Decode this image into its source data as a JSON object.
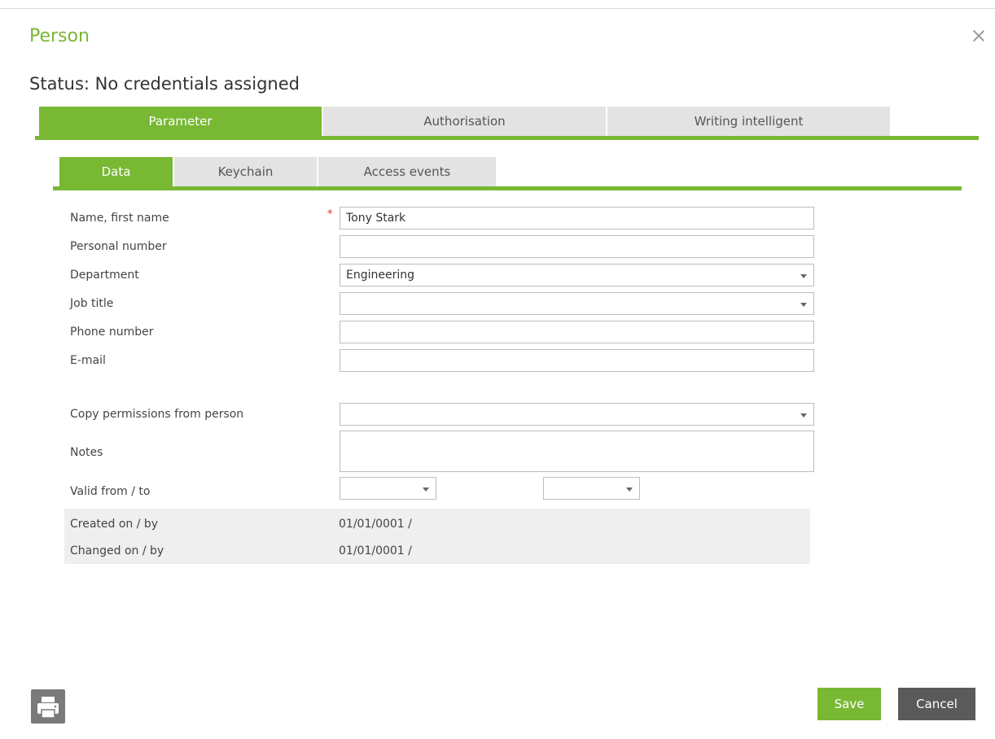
{
  "dialog": {
    "title": "Person",
    "status": "Status: No credentials assigned"
  },
  "tabs": [
    {
      "label": "Parameter",
      "active": true
    },
    {
      "label": "Authorisation",
      "active": false
    },
    {
      "label": "Writing intelligent",
      "active": false
    }
  ],
  "subtabs": [
    {
      "label": "Data",
      "active": true
    },
    {
      "label": "Keychain",
      "active": false
    },
    {
      "label": "Access events",
      "active": false
    }
  ],
  "form": {
    "name_label": "Name, first name",
    "required_mark": "*",
    "name_value": "Tony Stark",
    "personal_number_label": "Personal number",
    "personal_number_value": "",
    "department_label": "Department",
    "department_value": "Engineering",
    "job_title_label": "Job title",
    "job_title_value": "",
    "phone_label": "Phone number",
    "phone_value": "",
    "email_label": "E-mail",
    "email_value": "",
    "copy_permissions_label": "Copy permissions from person",
    "copy_permissions_value": "",
    "notes_label": "Notes",
    "valid_label": "Valid from / to",
    "valid_from_value": "",
    "valid_to_value": ""
  },
  "info": {
    "created_label": "Created on / by",
    "created_value": "01/01/0001  /",
    "changed_label": "Changed on / by",
    "changed_value": "01/01/0001  /"
  },
  "footer": {
    "save_label": "Save",
    "cancel_label": "Cancel"
  },
  "colors": {
    "accent": "#78b833",
    "tab_inactive": "#e3e3e3",
    "cancel_bg": "#5a5a5a",
    "required": "#d9372b"
  },
  "icons": {
    "close": "close-icon",
    "print": "printer-icon",
    "dropdown": "chevron-down-icon"
  }
}
